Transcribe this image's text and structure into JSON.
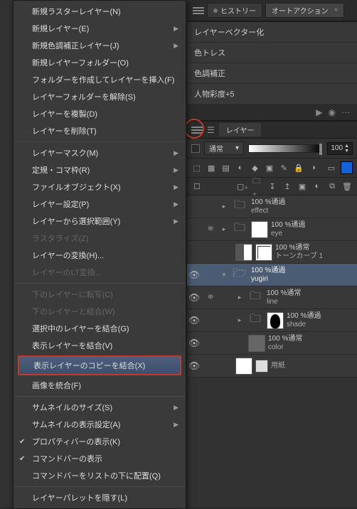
{
  "tabs": {
    "history": "ヒストリー",
    "autoaction": "オートアクション"
  },
  "actions": [
    "レイヤーベクター化",
    "色トレス",
    "色調補正",
    "人物彩度+5"
  ],
  "layerPanel": {
    "tab": "レイヤー",
    "blend": "通常",
    "opacity": "100",
    "spinner": "▲▼"
  },
  "layers": [
    {
      "op": "100 %通過",
      "nm": "effect",
      "folder": true
    },
    {
      "op": "100 %通過",
      "nm": "eye",
      "folder": true,
      "thumbWhite": true
    },
    {
      "op": "100 %通常",
      "nm": "トーンカーブ 1",
      "thumb": "curve",
      "mask": true
    },
    {
      "op": "100 %通過",
      "nm": "yugiri",
      "folder": true,
      "selected": true
    },
    {
      "op": "100 %通常",
      "nm": "line",
      "folder": true
    },
    {
      "op": "100 %通過",
      "nm": "shade",
      "thumb": "sil",
      "mask": true
    },
    {
      "op": "100 %通常",
      "nm": "color",
      "thumb": "gray"
    },
    {
      "op": "",
      "nm": "用紙",
      "thumb": "white",
      "mask": true
    }
  ],
  "menu": {
    "g1": [
      "新規ラスターレイヤー(N)",
      "新規レイヤー(E)",
      "新規色調補正レイヤー(J)",
      "新規レイヤーフォルダー(O)",
      "フォルダーを作成してレイヤーを挿入(F)",
      "レイヤーフォルダーを解除(S)",
      "レイヤーを複製(D)",
      "レイヤーを削除(T)"
    ],
    "g2": [
      "レイヤーマスク(M)",
      "定規・コマ枠(R)",
      "ファイルオブジェクト(X)",
      "レイヤー設定(P)",
      "レイヤーから選択範囲(Y)"
    ],
    "g2b": [
      "ラスタライズ(Z)",
      "レイヤーの変換(H)...",
      "レイヤーのLT変換..."
    ],
    "g3": [
      "下のレイヤーに転写(C)",
      "下のレイヤーと結合(W)",
      "選択中のレイヤーを結合(G)",
      "表示レイヤーを結合(V)"
    ],
    "g3hl": "表示レイヤーのコピーを結合(X)",
    "g3b": [
      "画像を統合(F)"
    ],
    "g4": [
      "サムネイルのサイズ(S)",
      "サムネイルの表示設定(A)"
    ],
    "g4c": [
      "プロパティバーの表示(K)",
      "コマンドバーの表示"
    ],
    "g4d": [
      "コマンドバーをリストの下に配置(Q)"
    ],
    "g5": [
      "レイヤーパレットを隠す(L)"
    ]
  }
}
